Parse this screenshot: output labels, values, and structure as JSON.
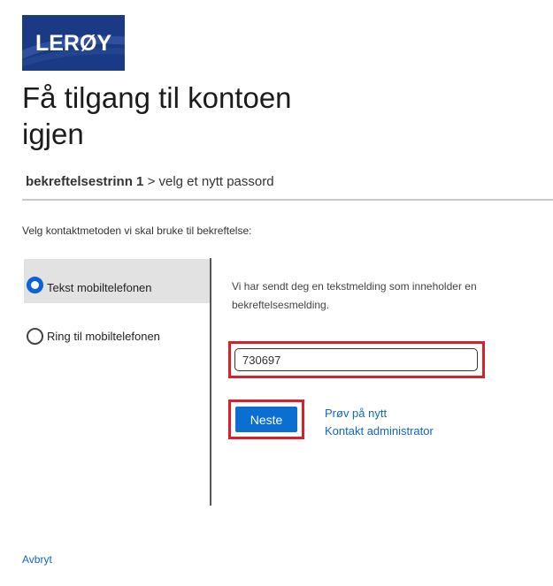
{
  "brand": {
    "logo_text": "LERØY",
    "logo_bg": "#1a3a85",
    "logo_fg": "#ffffff"
  },
  "page": {
    "title": "Få tilgang til kontoen igjen"
  },
  "breadcrumb": {
    "current_step": "bekreftelsestrinn 1",
    "separator": ">",
    "next_step": "velg et nytt passord"
  },
  "instruction": "Velg kontaktmetoden vi skal bruke til bekreftelse:",
  "contact_methods": [
    {
      "label": "Tekst mobiltelefonen",
      "selected": true
    },
    {
      "label": "Ring til mobiltelefonen",
      "selected": false
    }
  ],
  "verification": {
    "message": "Vi har sendt deg en tekstmelding som inneholder en bekreftelsesmelding.",
    "code_value": "730697"
  },
  "actions": {
    "next_label": "Neste",
    "retry_label": "Prøv på nytt",
    "contact_admin_label": "Kontakt administrator",
    "cancel_label": "Avbryt"
  },
  "colors": {
    "accent": "#0a6fd0",
    "link": "#1166c6",
    "highlight": "#d8202c",
    "selected_bg": "#e2e2e2"
  }
}
